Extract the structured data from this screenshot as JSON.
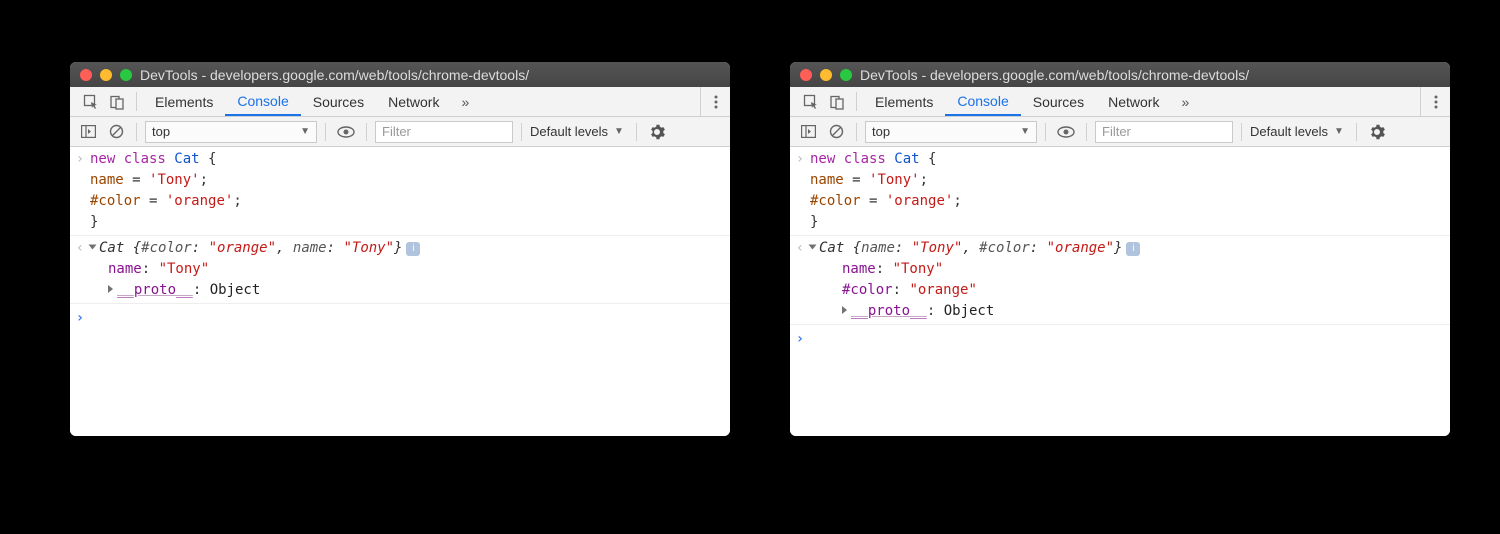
{
  "title": "DevTools - developers.google.com/web/tools/chrome-devtools/",
  "tabs": {
    "elements": "Elements",
    "console": "Console",
    "sources": "Sources",
    "network": "Network",
    "overflow": "»"
  },
  "toolbar": {
    "context": "top",
    "filter_placeholder": "Filter",
    "levels": "Default levels"
  },
  "input_code": {
    "line1_kw": "new class",
    "line1_cls": " Cat ",
    "line1_brace": "{",
    "line2_prop": "  name",
    "line2_eq": " = ",
    "line2_str": "'Tony'",
    "line2_semi": ";",
    "line3_prop": "  #color",
    "line3_eq": " = ",
    "line3_str": "'orange'",
    "line3_semi": ";",
    "line4": "}"
  },
  "left_output": {
    "header_cls": "Cat ",
    "header_open": "{",
    "k1": "#color",
    "colon": ": ",
    "v1": "\"orange\"",
    "comma": ", ",
    "k2": "name",
    "v2": "\"Tony\"",
    "header_close": "}",
    "line2_key": "name",
    "line2_val": "\"Tony\"",
    "proto_key": "__proto__",
    "proto_val": "Object"
  },
  "right_output": {
    "header_cls": "Cat ",
    "header_open": "{",
    "k1": "name",
    "colon": ": ",
    "v1": "\"Tony\"",
    "comma": ", ",
    "k2": "#color",
    "v2": "\"orange\"",
    "header_close": "}",
    "line2_key": "name",
    "line2_val": "\"Tony\"",
    "line3_key": "#color",
    "line3_val": "\"orange\"",
    "proto_key": "__proto__",
    "proto_val": "Object"
  }
}
